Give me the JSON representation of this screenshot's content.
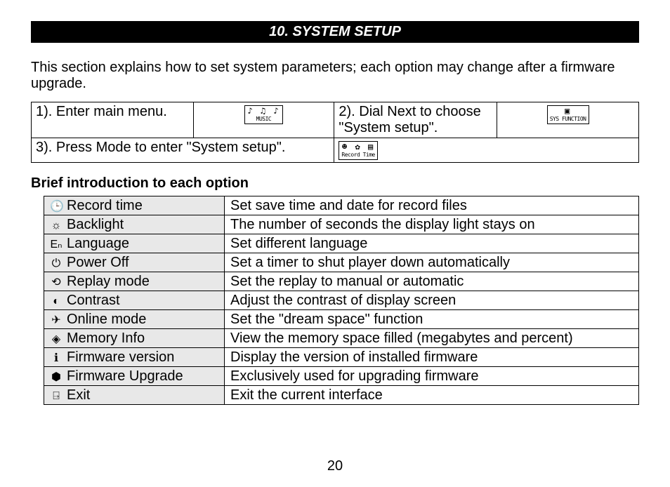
{
  "header": "10. SYSTEM SETUP",
  "intro": "This section explains how to set system parameters; each option may change after a firmware upgrade.",
  "steps": {
    "s1": "1). Enter main menu.",
    "s1_img_top": "♪ ♫ ♪",
    "s1_img_lab": "MUSIC",
    "s2": "2). Dial Next to choose \"System setup\".",
    "s2_img_top": "▣",
    "s2_img_lab": "SYS FUNCTION",
    "s3": "3). Press Mode to enter \"System setup\".",
    "s3_img_top": "☻ ✿ ▤",
    "s3_img_lab": "Record Time"
  },
  "subheader": "Brief introduction to each option",
  "options": [
    {
      "icon": "🕒",
      "name": "Record time",
      "desc": "Set save time and date for record files"
    },
    {
      "icon": "☼",
      "name": "Backlight",
      "desc": "The number of seconds the display light stays on"
    },
    {
      "icon": "Eₙ",
      "name": "Language",
      "desc": "Set different language"
    },
    {
      "icon": "⏻",
      "name": "Power Off",
      "desc": "Set a timer to shut player down automatically"
    },
    {
      "icon": "⟲",
      "name": "Replay mode",
      "desc": "Set the replay to manual or automatic"
    },
    {
      "icon": "◐",
      "name": "Contrast",
      "desc": "Adjust the contrast of display screen"
    },
    {
      "icon": "✈",
      "name": "Online mode",
      "desc": "Set the \"dream space\" function"
    },
    {
      "icon": "◈",
      "name": "Memory Info",
      "desc": "View the memory space filled (megabytes and percent)"
    },
    {
      "icon": "ℹ",
      "name": "Firmware version",
      "desc": "Display the version of installed firmware"
    },
    {
      "icon": "⬢",
      "name": "Firmware Upgrade",
      "desc": "Exclusively used for upgrading firmware"
    },
    {
      "icon": "⍈",
      "name": "Exit",
      "desc": "Exit the current interface"
    }
  ],
  "pagenum": "20"
}
